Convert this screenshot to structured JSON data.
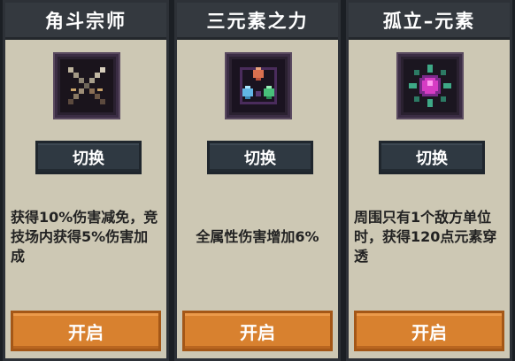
{
  "cards": [
    {
      "title": "角斗宗师",
      "icon": "crossed-swords-icon",
      "switch_label": "切换",
      "desc": "获得10%伤害减免，竞技场内获得5%伤害加成",
      "open_label": "开启"
    },
    {
      "title": "三元素之力",
      "icon": "three-element-crystals-icon",
      "switch_label": "切换",
      "desc": "全属性伤害增加6%",
      "open_label": "开启"
    },
    {
      "title": "孤立–元素",
      "icon": "isolated-element-orb-icon",
      "switch_label": "切换",
      "desc": "周围只有1个敌方单位时，获得120点元素穿透",
      "open_label": "开启"
    }
  ],
  "colors": {
    "card_bg": "#cdc8b4",
    "title_bg": "#34393f",
    "switch_bg": "#2f3942",
    "open_bg": "#d8812f"
  }
}
